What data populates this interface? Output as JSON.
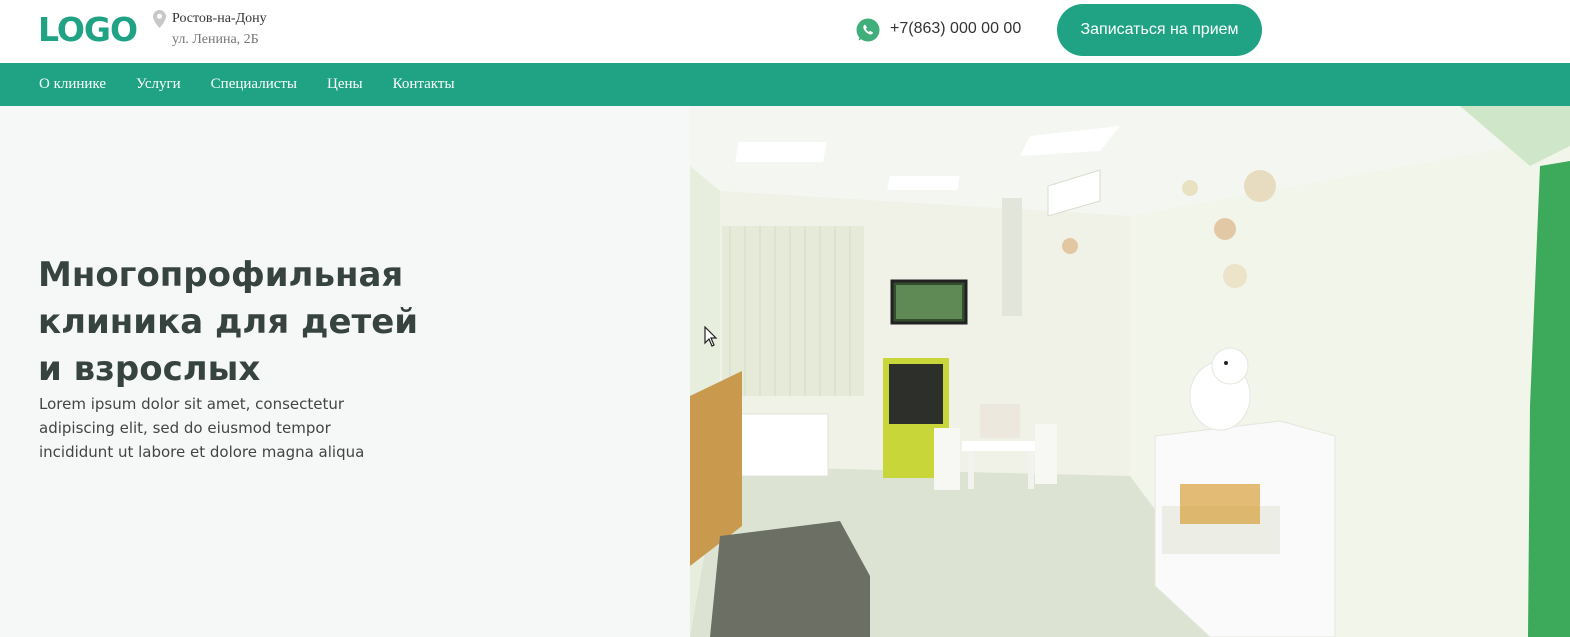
{
  "header": {
    "logo": "LOGO",
    "city": "Ростов-на-Дону",
    "street": "ул. Ленина, 2Б",
    "phone": "+7(863) 000 00 00",
    "cta_label": "Записаться на прием"
  },
  "nav": {
    "items": [
      "О клинике",
      "Услуги",
      "Специалисты",
      "Цены",
      "Контакты"
    ]
  },
  "hero": {
    "title": "Многопрофильная клиника для детей и взрослых",
    "text": "Lorem ipsum dolor sit amet, consectetur adipiscing elit, sed do eiusmod tempor incididunt ut labore et dolore magna aliqua"
  },
  "colors": {
    "accent": "#1fa384",
    "title": "#37433f",
    "hero_bg": "#f6f8f7"
  },
  "icons": {
    "location": "location-pin-icon",
    "messenger": "whatsapp-icon"
  }
}
